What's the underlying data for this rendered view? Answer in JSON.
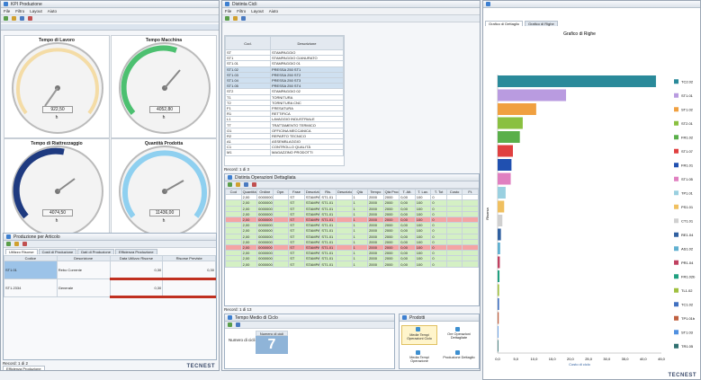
{
  "left_window": {
    "title": "KPI Produzione",
    "menu": [
      "File",
      "Filtro",
      "Layout",
      "Aiuto"
    ],
    "gauges": [
      {
        "title": "Tempo di Lavoro",
        "value": "922,50",
        "unit": "h"
      },
      {
        "title": "Tempo Macchina",
        "value": "4052,80",
        "unit": "h"
      },
      {
        "title": "Tempo di Riattrezzaggio",
        "value": "4074,50",
        "unit": "h"
      },
      {
        "title": "Quantità Prodotta",
        "value": "11436,00",
        "unit": "h"
      }
    ],
    "sub_title": "Produzione per Articolo",
    "sub_tabs": [
      "Utilizzo Risorse",
      "Costi di Produzione",
      "Dati di Produzione",
      "Efficienza Produzione"
    ],
    "sub_headers": [
      "Codice",
      "Descrizione",
      "Data Utilizzo Risorse",
      "Risorse Previste"
    ],
    "sub_rows": [
      {
        "code": "ST1.01",
        "desc": "Rebo Corrente",
        "v1": "0,30",
        "v2": "0,30"
      },
      {
        "code": "ST1.2334",
        "desc": "Generale",
        "v1": "0,30",
        "v2": ""
      }
    ],
    "record": "Record: 1 di 2",
    "bottom_tab": "Efficienza Produzione",
    "brand": "TECNEST"
  },
  "mid_window": {
    "title": "Distinta Cicli",
    "menu": [
      "File",
      "Filtro",
      "Layout",
      "Aiuto"
    ],
    "tree_headers": [
      "Cod.",
      "Descrizione"
    ],
    "tree_rows": [
      {
        "code": "ST",
        "desc": "STAMPAGGIO"
      },
      {
        "code": "ST1",
        "desc": "STAMPAGGIO CIANURATO"
      },
      {
        "code": "ST1.01",
        "desc": "STAMPAGGIO 01"
      },
      {
        "code": "ST1.02",
        "desc": "PRESSA 250 ST1"
      },
      {
        "code": "ST1.03",
        "desc": "PRESSA 250 ST2"
      },
      {
        "code": "ST1.04",
        "desc": "PRESSA 250 ST3"
      },
      {
        "code": "ST1.05",
        "desc": "PRESSA 250 ST4"
      },
      {
        "code": "ST2",
        "desc": "STAMPAGGIO 02"
      },
      {
        "code": "T1",
        "desc": "TORNITURA"
      },
      {
        "code": "T2",
        "desc": "TORNITURA CNC"
      },
      {
        "code": "F1",
        "desc": "FRESATURA"
      },
      {
        "code": "R1",
        "desc": "RETTIFICA"
      },
      {
        "code": "L1",
        "desc": "LAVAGGIO INDUSTRIALE"
      },
      {
        "code": "TT",
        "desc": "TRATTAMENTO TERMICO"
      },
      {
        "code": "O1",
        "desc": "OFFICINA MECCANICA"
      },
      {
        "code": "R2",
        "desc": "REPARTO TECNICO"
      },
      {
        "code": "A1",
        "desc": "ASSEMBLAGGIO"
      },
      {
        "code": "C1",
        "desc": "CONTROLLO QUALITÀ"
      },
      {
        "code": "M1",
        "desc": "MAGAZZINO PRODOTTI"
      }
    ],
    "record_top": "Record: 1 di 3",
    "grid_title": "Distinta Operazioni Dettagliata",
    "grid_headers": [
      "Cod",
      "Quantità",
      "Ordine",
      "Ope.",
      "Fase",
      "Descrizione Fase",
      "Ris.",
      "Descrizione",
      "Qtà",
      "Tempo",
      "Qtà Prod.",
      "T. Att.",
      "T. Lav.",
      "T. Tot",
      "Costo",
      "Ft."
    ],
    "grid_rows": [
      {
        "q": "2,00",
        "o": "000000070",
        "f": "ST",
        "d": "STAMPAGGIO",
        "r": "ST1.01",
        "a": "1",
        "b": "2000",
        "c": "2000",
        "e": "0,00",
        "g": "100",
        "h": "0",
        "s": "normal"
      },
      {
        "q": "2,00",
        "o": "000000071",
        "f": "ST",
        "d": "STAMPAGGIO",
        "r": "ST1.01",
        "a": "1",
        "b": "2000",
        "c": "2000",
        "e": "0,00",
        "g": "100",
        "h": "0",
        "s": "green"
      },
      {
        "q": "2,00",
        "o": "000000072",
        "f": "ST",
        "d": "STAMPAGGIO",
        "r": "ST1.01",
        "a": "1",
        "b": "2000",
        "c": "2000",
        "e": "0,00",
        "g": "100",
        "h": "0",
        "s": "green"
      },
      {
        "q": "2,00",
        "o": "000000073",
        "f": "ST",
        "d": "STAMPAGGIO",
        "r": "ST1.01",
        "a": "1",
        "b": "2000",
        "c": "2000",
        "e": "0,00",
        "g": "100",
        "h": "0",
        "s": "green"
      },
      {
        "q": "2,00",
        "o": "000000074",
        "f": "ST",
        "d": "STAMPAGGIO",
        "r": "ST1.01",
        "a": "1",
        "b": "2000",
        "c": "2000",
        "e": "0,00",
        "g": "100",
        "h": "0",
        "s": "red"
      },
      {
        "q": "2,00",
        "o": "000000075",
        "f": "ST",
        "d": "STAMPAGGIO",
        "r": "ST1.01",
        "a": "1",
        "b": "2000",
        "c": "2000",
        "e": "0,00",
        "g": "100",
        "h": "0",
        "s": "green"
      },
      {
        "q": "2,00",
        "o": "000000076",
        "f": "ST",
        "d": "STAMPAGGIO",
        "r": "ST1.01",
        "a": "1",
        "b": "2000",
        "c": "2000",
        "e": "0,00",
        "g": "100",
        "h": "0",
        "s": "green"
      },
      {
        "q": "2,00",
        "o": "000000077",
        "f": "ST",
        "d": "STAMPAGGIO",
        "r": "ST1.01",
        "a": "1",
        "b": "2000",
        "c": "2000",
        "e": "0,00",
        "g": "100",
        "h": "0",
        "s": "green"
      },
      {
        "q": "2,00",
        "o": "000000078",
        "f": "ST",
        "d": "STAMPAGGIO",
        "r": "ST1.01",
        "a": "1",
        "b": "2000",
        "c": "2000",
        "e": "0,00",
        "g": "100",
        "h": "0",
        "s": "green"
      },
      {
        "q": "2,00",
        "o": "000000079",
        "f": "ST",
        "d": "STAMPAGGIO",
        "r": "ST1.01",
        "a": "1",
        "b": "2000",
        "c": "2000",
        "e": "0,00",
        "g": "100",
        "h": "0",
        "s": "red"
      },
      {
        "q": "2,00",
        "o": "000000080",
        "f": "ST",
        "d": "STAMPAGGIO",
        "r": "ST1.01",
        "a": "1",
        "b": "2000",
        "c": "2000",
        "e": "0,00",
        "g": "100",
        "h": "0",
        "s": "green"
      },
      {
        "q": "2,00",
        "o": "000000081",
        "f": "ST",
        "d": "STAMPAGGIO",
        "r": "ST1.01",
        "a": "1",
        "b": "2000",
        "c": "2000",
        "e": "0,00",
        "g": "100",
        "h": "0",
        "s": "green"
      },
      {
        "q": "2,00",
        "o": "000000082",
        "f": "ST",
        "d": "STAMPAGGIO",
        "r": "ST1.01",
        "a": "1",
        "b": "2000",
        "c": "2000",
        "e": "0,00",
        "g": "100",
        "h": "0",
        "s": "green"
      }
    ],
    "record_grid": "Record: 1 di 13",
    "bottom_left_title": "Tempo Medio di Ciclo",
    "bottom_left_label": "Numero di cicli",
    "bottom_left_value": "7",
    "bottom_left_header": "Numero di cicli",
    "bottom_right_title": "Prodotti",
    "shortcuts": [
      "Medie Tempi Operazioni Ciclo",
      "Ore Operazioni Dettagliate",
      "Media Tempi Operazione",
      "Produzione Dettaglio"
    ]
  },
  "right_panel": {
    "tabs": [
      "Grafico di Dettaglio",
      "Grafico di Righe"
    ],
    "brand": "TECNEST"
  },
  "chart_data": {
    "type": "bar",
    "orientation": "horizontal",
    "title": "Grafico di Righe",
    "ylabel": "Risorsa",
    "xlabel": "Costo di ciclo",
    "xlim": [
      0,
      45
    ],
    "xticks": [
      "0,0",
      "5,0",
      "10,0",
      "15,0",
      "20,0",
      "25,0",
      "30,0",
      "35,0",
      "40,0",
      "45,0"
    ],
    "categories": [
      "TC2.02",
      "ST1.01",
      "ST1.02",
      "ST2.01",
      "FR1.02",
      "ST1.07",
      "FR1.01",
      "ST1.05",
      "TP1.01",
      "PS1.01",
      "CT1.01",
      "RE1.04",
      "AS1.02",
      "PR1.04",
      "FR1.02b",
      "TL1.02",
      "TC1.02",
      "TP1.01b",
      "ST1.03",
      "TR1.05"
    ],
    "values": [
      43.5,
      18.8,
      10.6,
      6.9,
      6.1,
      4.2,
      3.8,
      3.6,
      2.2,
      1.8,
      1.3,
      0.9,
      0.7,
      0.6,
      0.5,
      0.4,
      0.4,
      0.3,
      0.2,
      0.2
    ],
    "colors": [
      "#2a8a9a",
      "#b99be0",
      "#f0a040",
      "#8ac040",
      "#5aaf4a",
      "#e04040",
      "#2050b0",
      "#e080c0",
      "#9ad0e0",
      "#f0c060",
      "#d0d0d0",
      "#3060a0",
      "#60b0d0",
      "#c04060",
      "#20a080",
      "#a0c040",
      "#4070c0",
      "#c06040",
      "#5090e0",
      "#307070"
    ]
  }
}
